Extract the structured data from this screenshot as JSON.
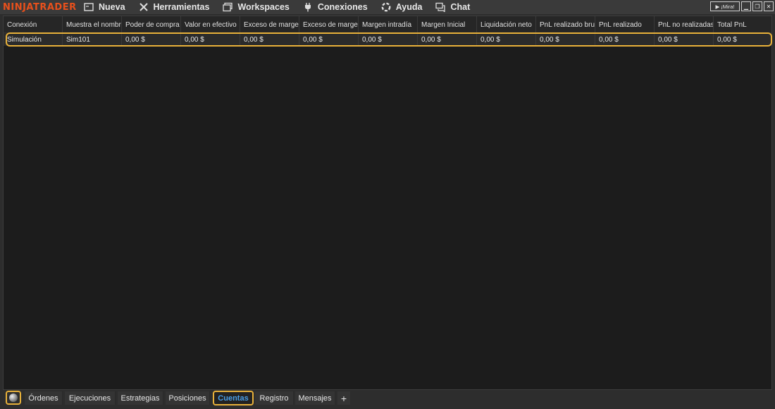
{
  "brand": {
    "name": "NINJATRADER",
    "color": "#e8501c"
  },
  "menu": [
    {
      "label": "Nueva",
      "icon": "new-window-icon"
    },
    {
      "label": "Herramientas",
      "icon": "tools-icon"
    },
    {
      "label": "Workspaces",
      "icon": "workspaces-icon"
    },
    {
      "label": "Conexiones",
      "icon": "plug-icon"
    },
    {
      "label": "Ayuda",
      "icon": "help-lifebuoy-icon"
    },
    {
      "label": "Chat",
      "icon": "chat-icon"
    }
  ],
  "window_controls": {
    "mira_label": "¡Mira!"
  },
  "grid": {
    "columns": [
      "Conexión",
      "Muestra el nombre",
      "Poder de compra",
      "Valor en efectivo",
      "Exceso de margen",
      "Exceso de margen",
      "Margen intradía",
      "Margen Inicial",
      "Liquidación neto",
      "PnL realizado bruto",
      "PnL realizado",
      "PnL no realizadas",
      "Total PnL"
    ],
    "rows": [
      [
        "Simulación",
        "Sim101",
        "0,00 $",
        "0,00 $",
        "0,00 $",
        "0,00 $",
        "0,00 $",
        "0,00 $",
        "0,00 $",
        "0,00 $",
        "0,00 $",
        "0,00 $",
        "0,00 $"
      ]
    ]
  },
  "tabs": {
    "items": [
      "Órdenes",
      "Ejecuciones",
      "Estrategias",
      "Posiciones",
      "Cuentas",
      "Registro",
      "Mensajes"
    ],
    "active": "Cuentas",
    "add_label": "+"
  },
  "colors": {
    "highlight": "#e8b13a",
    "active_tab_text": "#4a9fe8"
  }
}
